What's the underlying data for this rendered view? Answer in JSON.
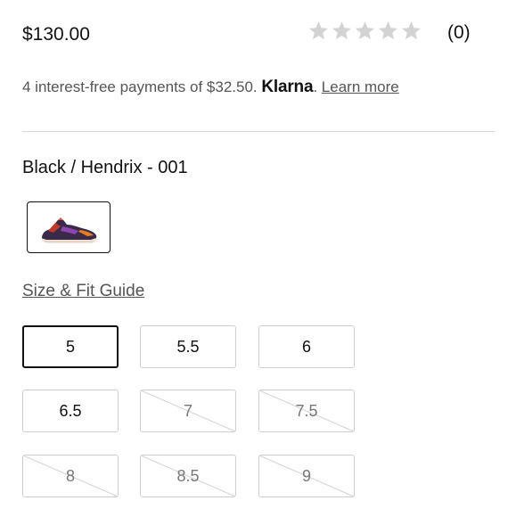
{
  "product": {
    "price": "$130.00",
    "rating": {
      "value": 0,
      "max": 5,
      "count": "(0)",
      "star_color": "#d3d3d3"
    }
  },
  "klarna": {
    "text": "4 interest-free payments of $32.50.",
    "brand": "Klarna",
    "period": ".",
    "link": "Learn more"
  },
  "color": {
    "name": "Black / Hendrix - 001",
    "swatch_icon": "sneaker-thumbnail"
  },
  "size_guide": "Size & Fit Guide",
  "sizes": [
    {
      "label": "5",
      "state": "selected"
    },
    {
      "label": "5.5",
      "state": "available"
    },
    {
      "label": "6",
      "state": "available"
    },
    {
      "label": "6.5",
      "state": "available"
    },
    {
      "label": "7",
      "state": "unavailable"
    },
    {
      "label": "7.5",
      "state": "unavailable"
    },
    {
      "label": "8",
      "state": "unavailable"
    },
    {
      "label": "8.5",
      "state": "unavailable"
    },
    {
      "label": "9",
      "state": "unavailable"
    }
  ],
  "colors": {
    "text": "#111111",
    "muted": "#555555",
    "divider": "#d7d7d7",
    "button_border": "#cfcfcf"
  }
}
